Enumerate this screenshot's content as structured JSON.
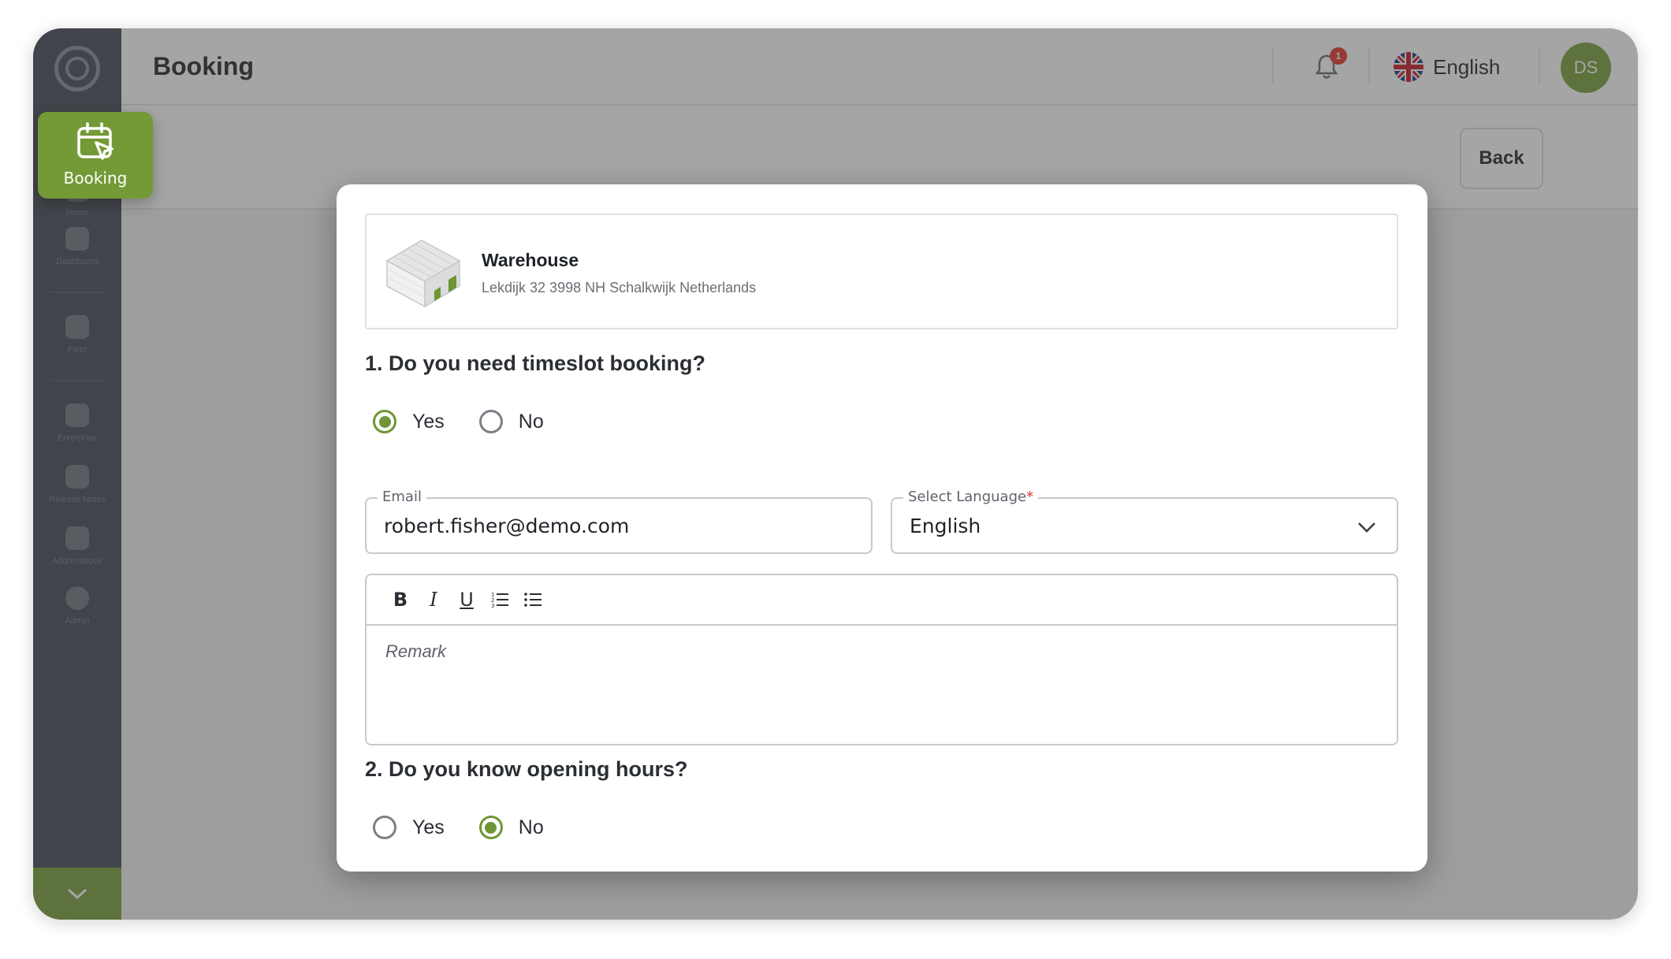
{
  "app": {
    "page_title": "Booking",
    "notification_count": "1",
    "language_label": "English",
    "user_initials": "DS",
    "back_label": "Back"
  },
  "sidebar": {
    "active_item": {
      "label": "Booking",
      "icon": "calendar-cursor-icon"
    },
    "items": [
      {
        "label": "Home",
        "icon": "home-icon"
      },
      {
        "label": "Dashboard",
        "icon": "dashboard-icon"
      },
      {
        "label": "Fleet",
        "icon": "fleet-icon"
      },
      {
        "label": "Enterprise",
        "icon": "enterprise-icon"
      },
      {
        "label": "Release Notes",
        "icon": "release-notes-icon"
      },
      {
        "label": "Addressbook",
        "icon": "addressbook-icon"
      },
      {
        "label": "Admin",
        "icon": "admin-icon"
      }
    ]
  },
  "modal": {
    "location": {
      "name": "Warehouse",
      "address": "Lekdijk 32 3998 NH Schalkwijk Netherlands"
    },
    "q1": {
      "title": "1. Do you need timeslot booking?",
      "options": [
        "Yes",
        "No"
      ],
      "selected": "Yes"
    },
    "email": {
      "label": "Email",
      "value": "robert.fisher@demo.com"
    },
    "language": {
      "label": "Select Language",
      "required_mark": "*",
      "value": "English"
    },
    "editor": {
      "placeholder": "Remark",
      "toolbar": [
        "B",
        "I",
        "U",
        "ordered-list",
        "bullet-list"
      ]
    },
    "q2": {
      "title": "2. Do you know opening hours?",
      "options": [
        "Yes",
        "No"
      ],
      "selected": "No"
    }
  },
  "colors": {
    "accent": "#6f9534",
    "sidebar": "#4a4f59",
    "required": "#d4352b"
  }
}
